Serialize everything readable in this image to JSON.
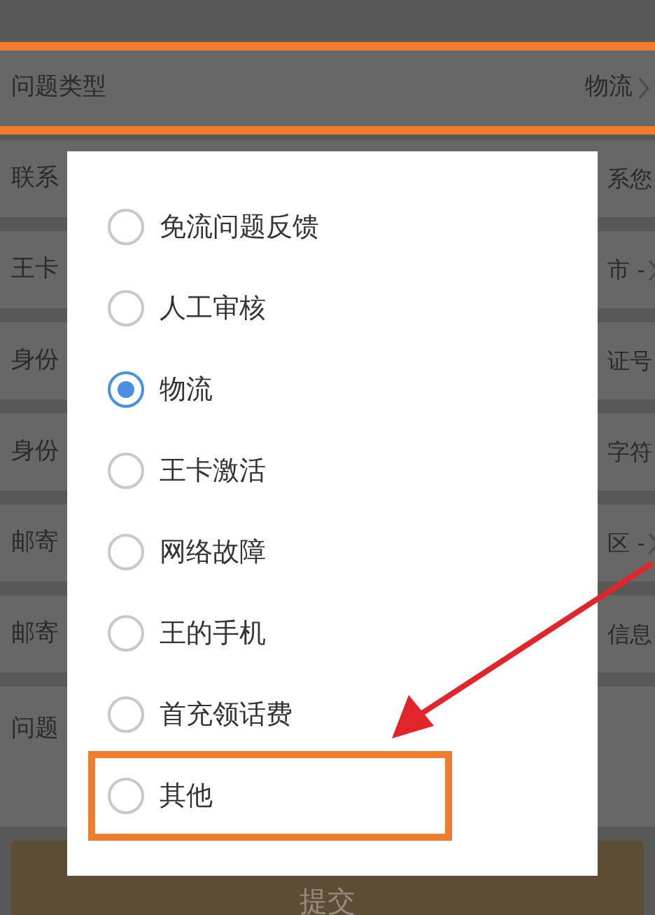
{
  "type_row": {
    "label": "问题类型",
    "value": "物流",
    "highlighted": true
  },
  "rows": [
    {
      "label": "联系",
      "value": "系您",
      "chevron": false,
      "tall": false
    },
    {
      "label": "王卡",
      "value": "市 -",
      "chevron": true,
      "tall": false
    },
    {
      "label": "身份",
      "value": "证号",
      "chevron": false,
      "tall": false
    },
    {
      "label": "身份",
      "value": "字符",
      "chevron": false,
      "tall": false
    },
    {
      "label": "邮寄",
      "value": "区 -",
      "chevron": true,
      "tall": false
    },
    {
      "label": "邮寄",
      "value": "信息",
      "chevron": false,
      "tall": false
    },
    {
      "label": "问题",
      "tall": true
    }
  ],
  "dialog": {
    "options": [
      {
        "label": "免流问题反馈",
        "selected": false,
        "highlighted": false
      },
      {
        "label": "人工审核",
        "selected": false,
        "highlighted": false
      },
      {
        "label": "物流",
        "selected": true,
        "highlighted": false
      },
      {
        "label": "王卡激活",
        "selected": false,
        "highlighted": false
      },
      {
        "label": "网络故障",
        "selected": false,
        "highlighted": false
      },
      {
        "label": "王的手机",
        "selected": false,
        "highlighted": false
      },
      {
        "label": "首充领话费",
        "selected": false,
        "highlighted": false
      },
      {
        "label": "其他",
        "selected": false,
        "highlighted": true
      }
    ]
  },
  "submit": "提交"
}
